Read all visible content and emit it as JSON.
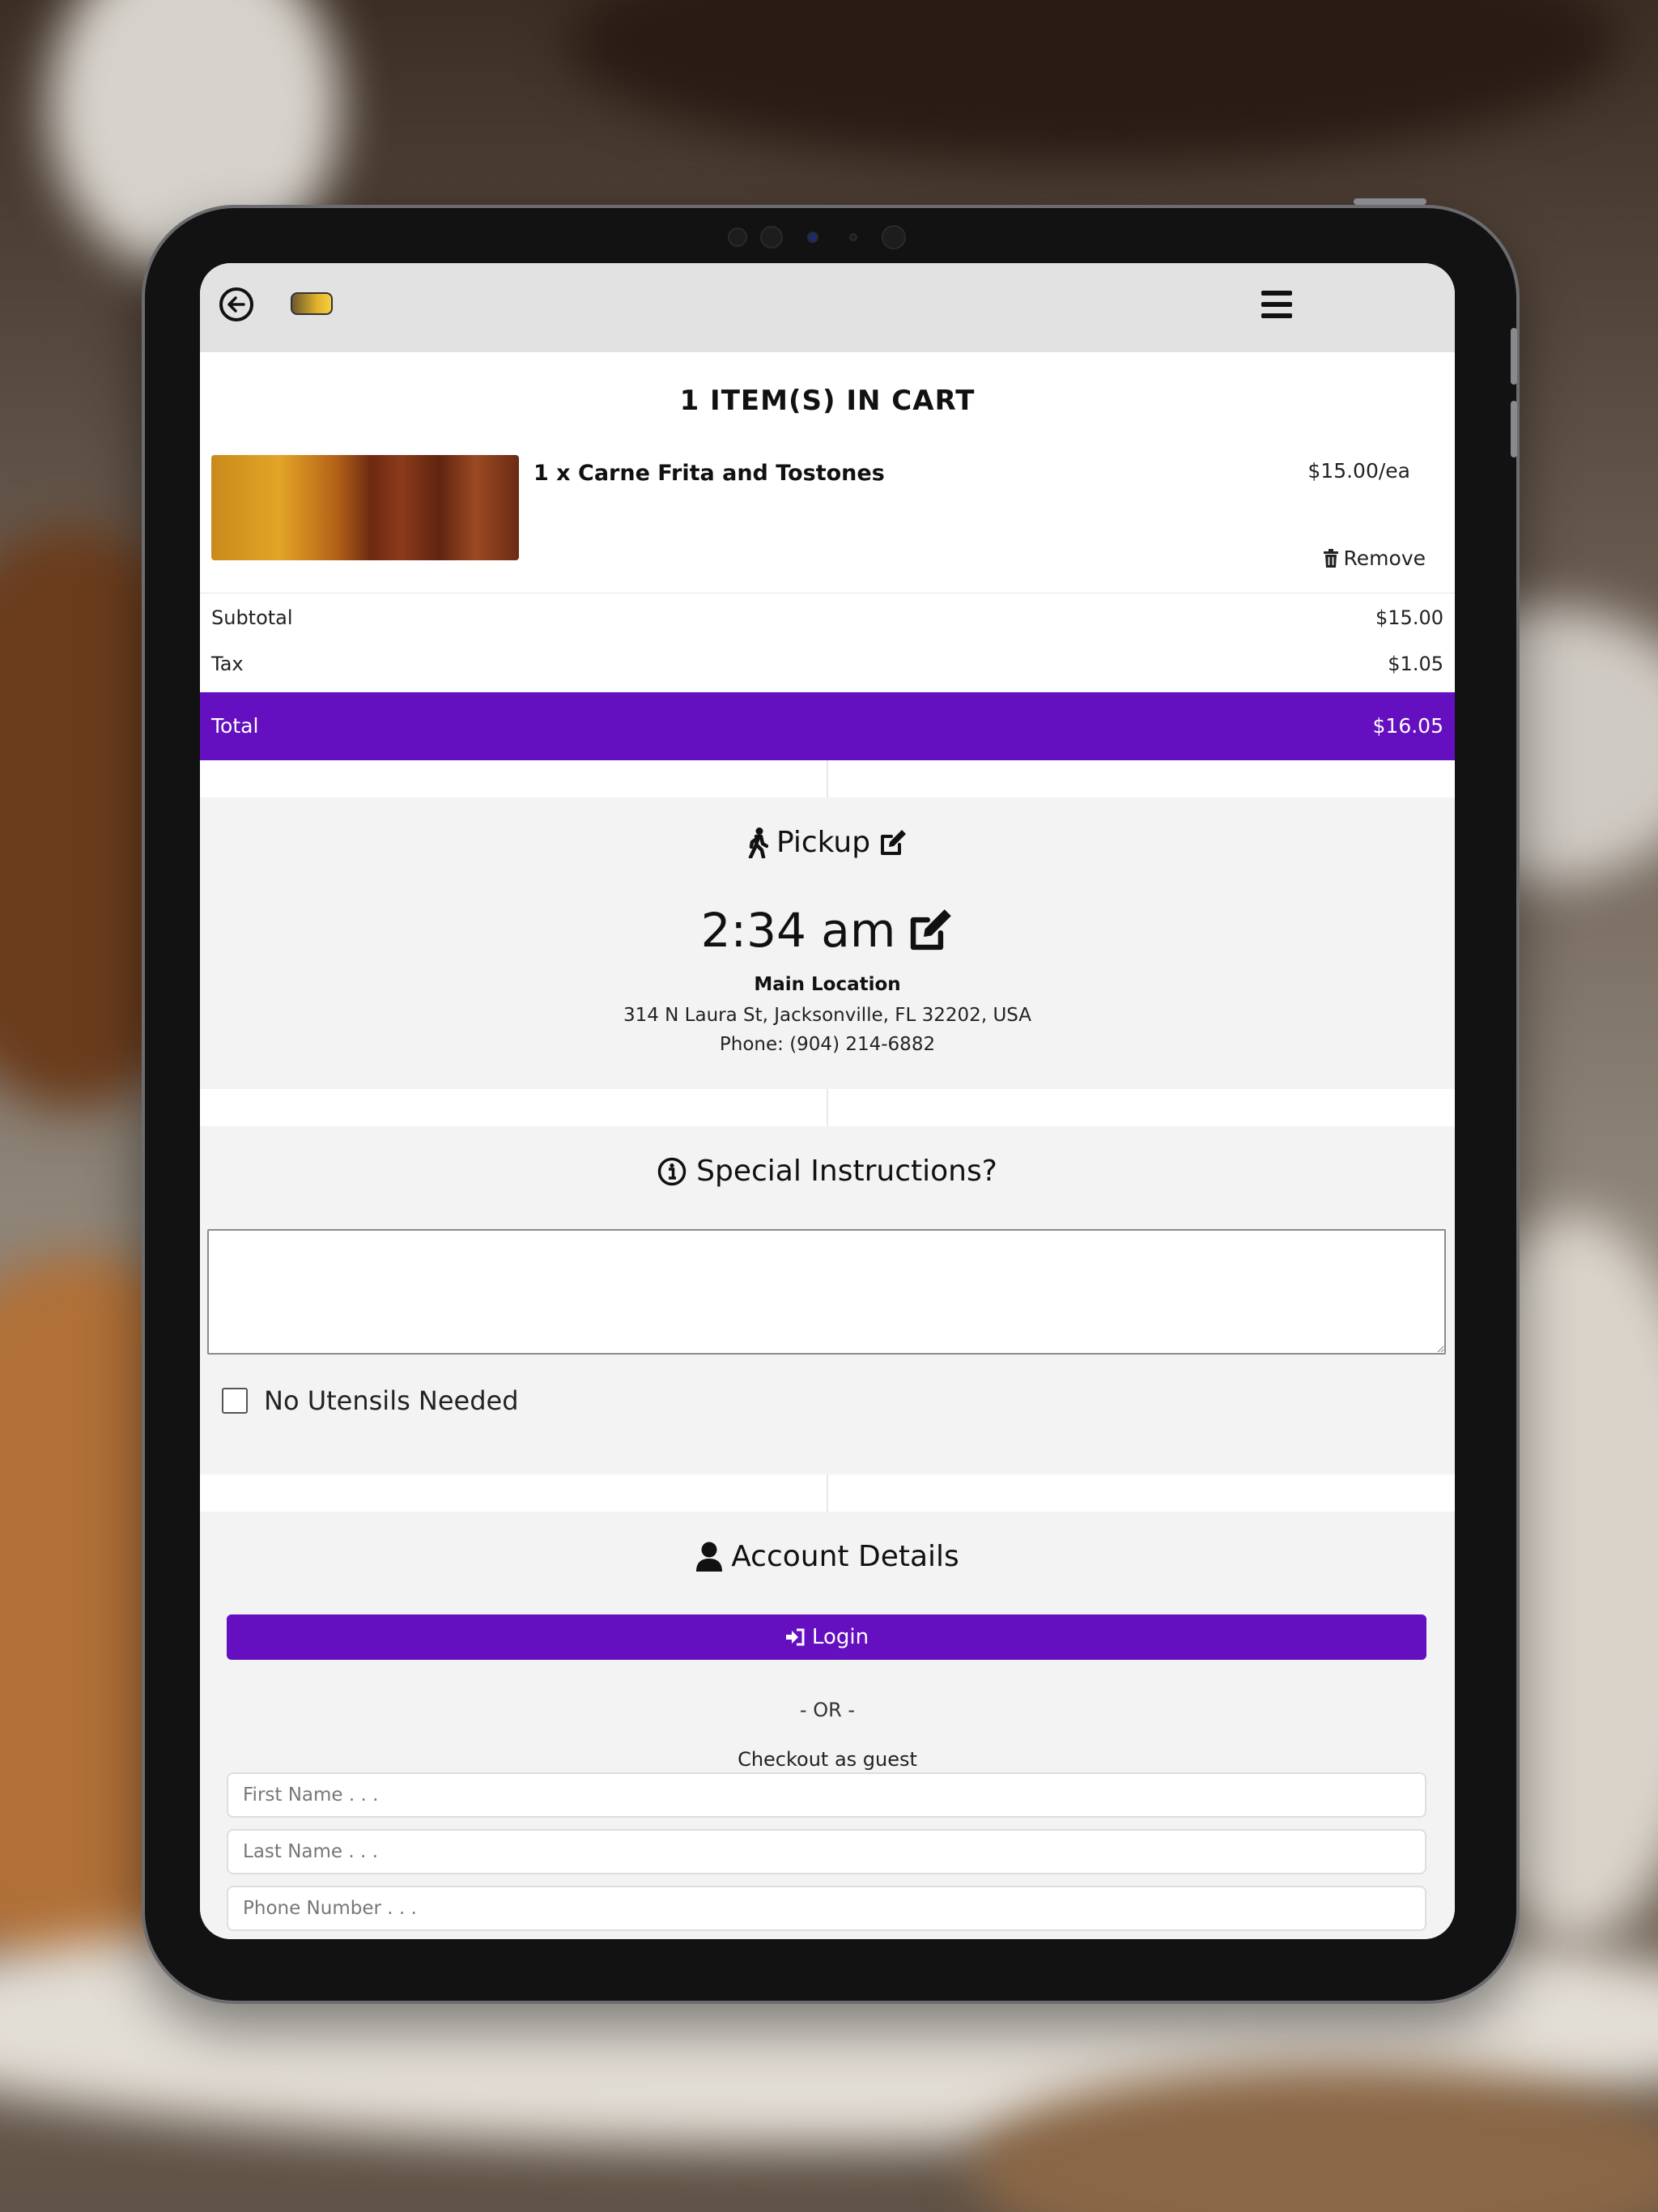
{
  "header": {
    "back_icon": "arrow-left-circle-icon",
    "logo_icon": "restaurant-logo",
    "menu_icon": "hamburger-menu-icon"
  },
  "cart": {
    "title": "1 ITEM(S) IN CART",
    "items": [
      {
        "name": "1 x Carne Frita and Tostones",
        "price": "$15.00/ea",
        "remove_label": "Remove",
        "remove_icon": "trash-icon"
      }
    ],
    "subtotal_label": "Subtotal",
    "subtotal_value": "$15.00",
    "tax_label": "Tax",
    "tax_value": "$1.05",
    "total_label": "Total",
    "total_value": "$16.05"
  },
  "pickup": {
    "title": "Pickup",
    "time": "2:34 am",
    "location_name": "Main Location",
    "address": "314 N Laura St, Jacksonville, FL 32202, USA",
    "phone": "Phone: (904) 214-6882"
  },
  "special_instructions": {
    "title": "Special Instructions?",
    "value": "",
    "no_utensils_label": "No Utensils Needed",
    "no_utensils_checked": false
  },
  "account": {
    "title": "Account Details",
    "login_label": "Login",
    "or_text": "- OR -",
    "guest_text": "Checkout as guest",
    "first_name_placeholder": "First Name . . .",
    "last_name_placeholder": "Last Name . . .",
    "phone_placeholder": "Phone Number . . ."
  },
  "colors": {
    "accent": "#6510c0",
    "panel_bg": "#f3f3f3",
    "header_bg": "#e2e2e2"
  }
}
